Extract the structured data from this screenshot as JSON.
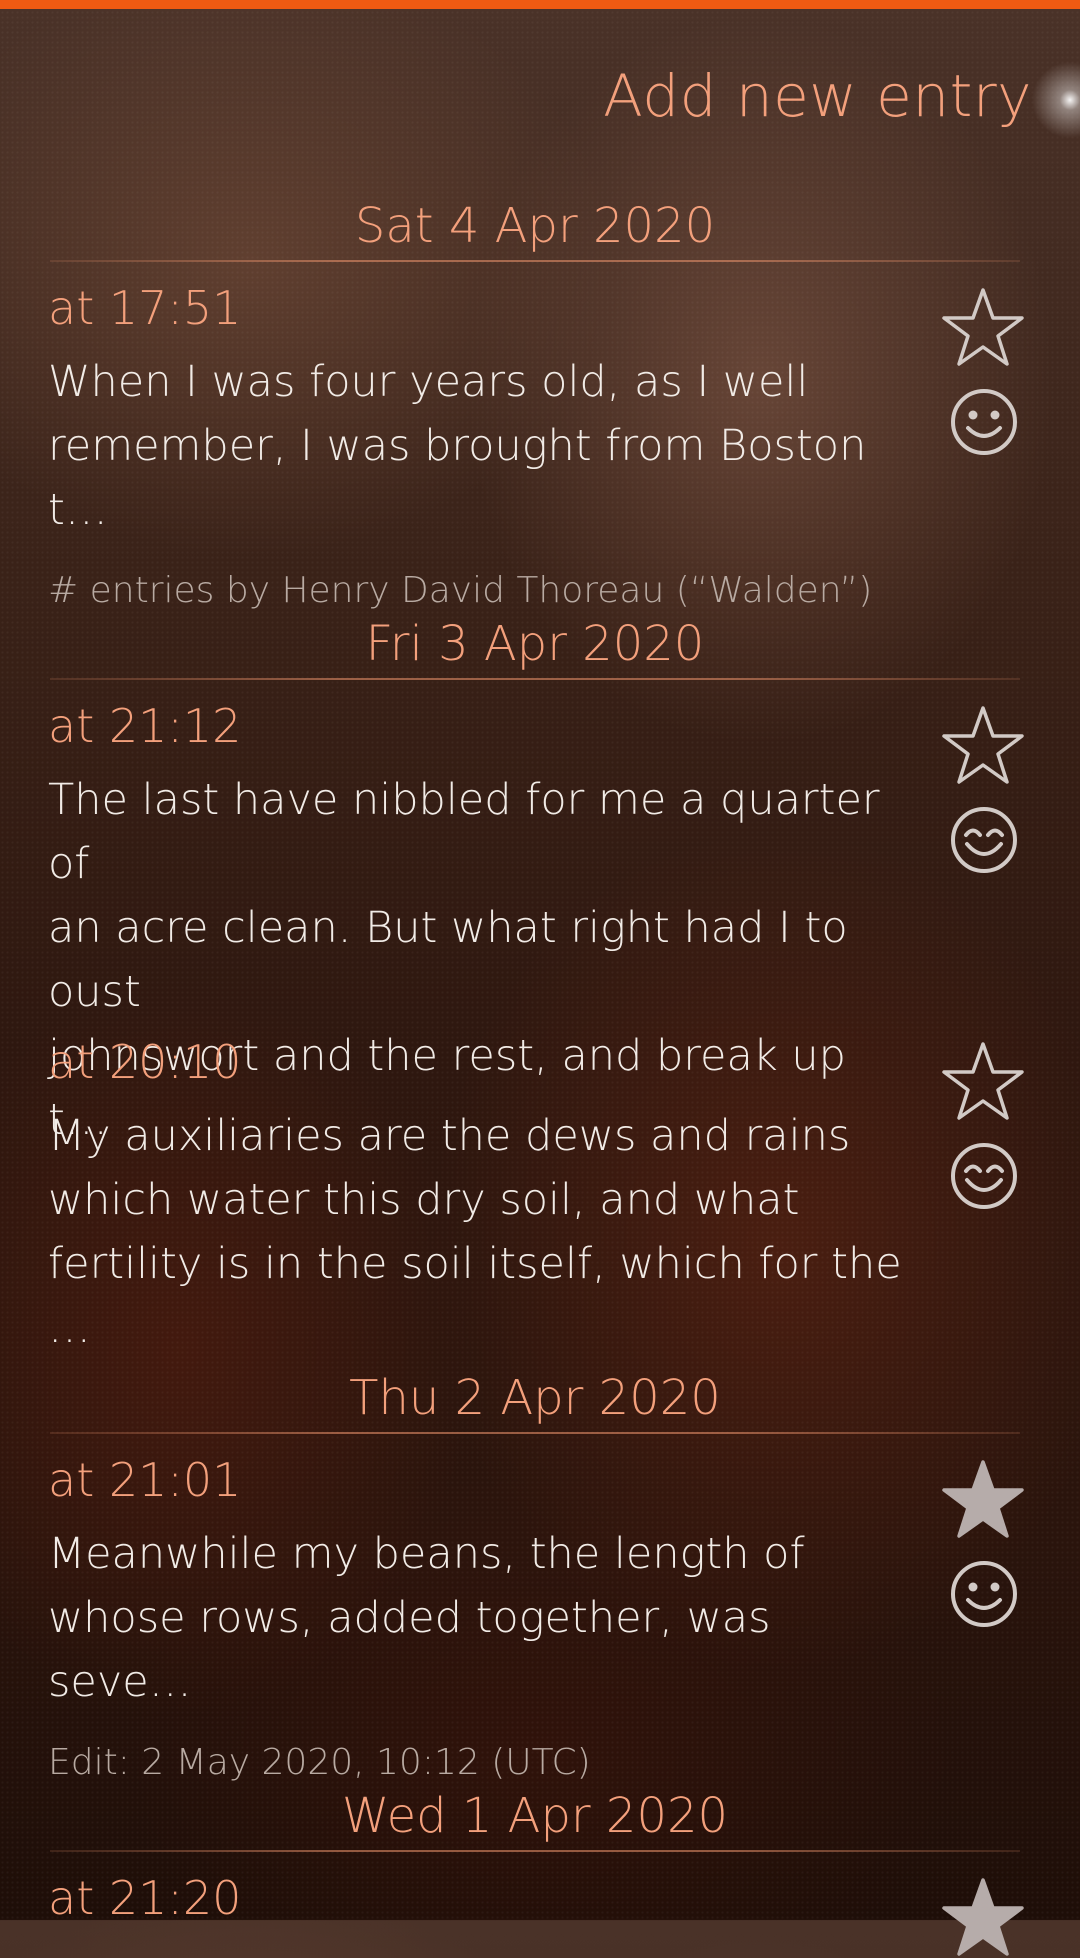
{
  "header": {
    "title": "Add new entry"
  },
  "sections": [
    {
      "date": "Sat 4 Apr 2020",
      "entries": [
        {
          "time": "at 17:51",
          "lines": [
            "When I was four years old, as I well",
            "remember, I was brought from Boston t…"
          ],
          "note": "# entries by Henry David Thoreau (“Walden”)",
          "favorite": false,
          "mood": "smile-icon"
        }
      ]
    },
    {
      "date": "Fri 3 Apr 2020",
      "entries": [
        {
          "time": "at 21:12",
          "lines": [
            "The last have nibbled for me a quarter of",
            "an acre clean. But what right had I to oust",
            "johnswort and the rest, and break up t…"
          ],
          "favorite": false,
          "mood": "happy-face-icon"
        },
        {
          "time": "at 20:10",
          "lines": [
            "My auxiliaries are the dews and rains",
            "which water this dry soil, and what",
            "fertility is in the soil itself, which for the …"
          ],
          "favorite": false,
          "mood": "happy-face-icon"
        }
      ]
    },
    {
      "date": "Thu 2 Apr 2020",
      "entries": [
        {
          "time": "at 21:01",
          "lines": [
            "Meanwhile my beans, the length of",
            "whose rows, added together, was seve…"
          ],
          "note": "Edit: 2 May 2020, 10:12 (UTC)",
          "favorite": true,
          "mood": "smile-icon"
        }
      ]
    },
    {
      "date": "Wed 1 Apr 2020",
      "entries": [
        {
          "time": "at 21:20",
          "favorite": true
        }
      ]
    }
  ],
  "colors": {
    "accent": "#ef5a12",
    "highlight": "#f3a07c",
    "primary_text": "#f1ebe6",
    "secondary_text": "#b8aaa2",
    "icon": "#d2cac6"
  }
}
